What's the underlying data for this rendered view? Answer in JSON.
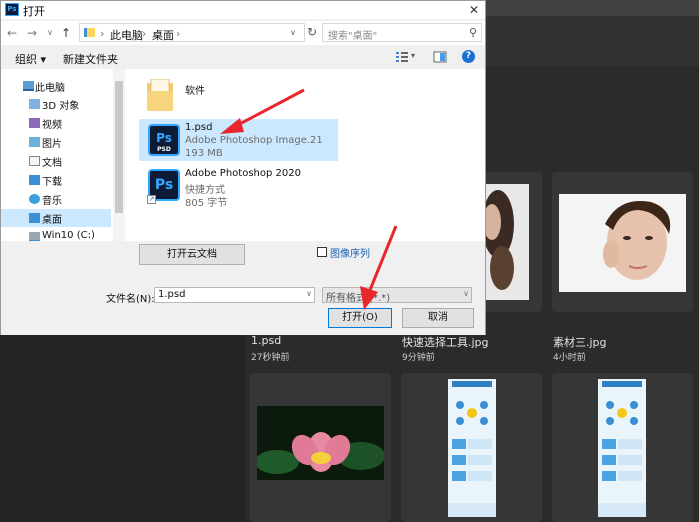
{
  "dialog": {
    "title": "打开",
    "close": "✕",
    "breadcrumb": [
      "此电脑",
      "桌面"
    ],
    "breadcrumb_sep": "›",
    "search_placeholder": "搜索\"桌面\"",
    "toolbar": {
      "organize": "组织 ▾",
      "new_folder": "新建文件夹"
    },
    "sidebar": [
      {
        "label": "此电脑",
        "icon": "computer-icon"
      },
      {
        "label": "3D 对象",
        "icon": "cube-folder-icon"
      },
      {
        "label": "视频",
        "icon": "video-folder-icon"
      },
      {
        "label": "图片",
        "icon": "picture-folder-icon"
      },
      {
        "label": "文档",
        "icon": "document-folder-icon"
      },
      {
        "label": "下载",
        "icon": "download-folder-icon"
      },
      {
        "label": "音乐",
        "icon": "music-folder-icon"
      },
      {
        "label": "桌面",
        "icon": "desktop-folder-icon",
        "selected": true
      },
      {
        "label": "Win10 (C:)",
        "icon": "drive-icon"
      }
    ],
    "files": [
      {
        "name": "软件",
        "type": "",
        "size": ""
      },
      {
        "name": "1.psd",
        "type": "Adobe Photoshop Image.21",
        "size": "193 MB"
      },
      {
        "name": "Adobe Photoshop 2020",
        "type": "快捷方式",
        "size": "805 字节"
      }
    ],
    "open_cloud_button": "打开云文档",
    "image_sequence_label": "图像序列",
    "filename_label": "文件名(N):",
    "filename_value": "1.psd",
    "filetype_value": "所有格式 (*.*)",
    "open_button": "打开(O)",
    "cancel_button": "取消"
  },
  "photoshop": {
    "recent_files": [
      {
        "name": "1.psd",
        "time": "27秒钟前"
      },
      {
        "name": "快速选择工具.jpg",
        "time": "9分钟前"
      },
      {
        "name": "素材三.jpg",
        "time": "4小时前"
      }
    ]
  },
  "colors": {
    "selection": "#cce8ff",
    "ps_blue": "#31a8ff",
    "arrow_red": "#e8262c"
  }
}
